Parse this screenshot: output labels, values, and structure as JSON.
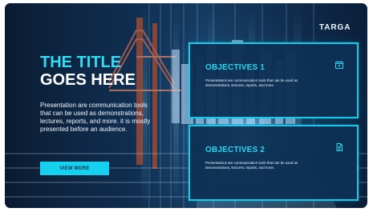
{
  "brand": {
    "logo": "TARGA"
  },
  "hero": {
    "title_line_1": "THE TITLE",
    "title_line_2": "GOES HERE",
    "description": "Presentation are communication tools that can be used as demonstrations, lectures, reports, and more. it is mostly presented before an audience.",
    "button_label": "VIEW MORE"
  },
  "cards": [
    {
      "title": "OBJECTIVES 1",
      "text": "Presentations are communication tools that can be used as demonstrations, lectures, reports, and more.",
      "icon": "calendar-icon"
    },
    {
      "title": "OBJECTIVES 2",
      "text": "Presentations are communication tools that can be used as demonstrations, lectures, reports, and more.",
      "icon": "document-icon"
    }
  ],
  "colors": {
    "accent": "#28d8f2",
    "title_white": "#ffffff",
    "card_bg": "#0e3054",
    "button_text": "#0a2c4a"
  }
}
